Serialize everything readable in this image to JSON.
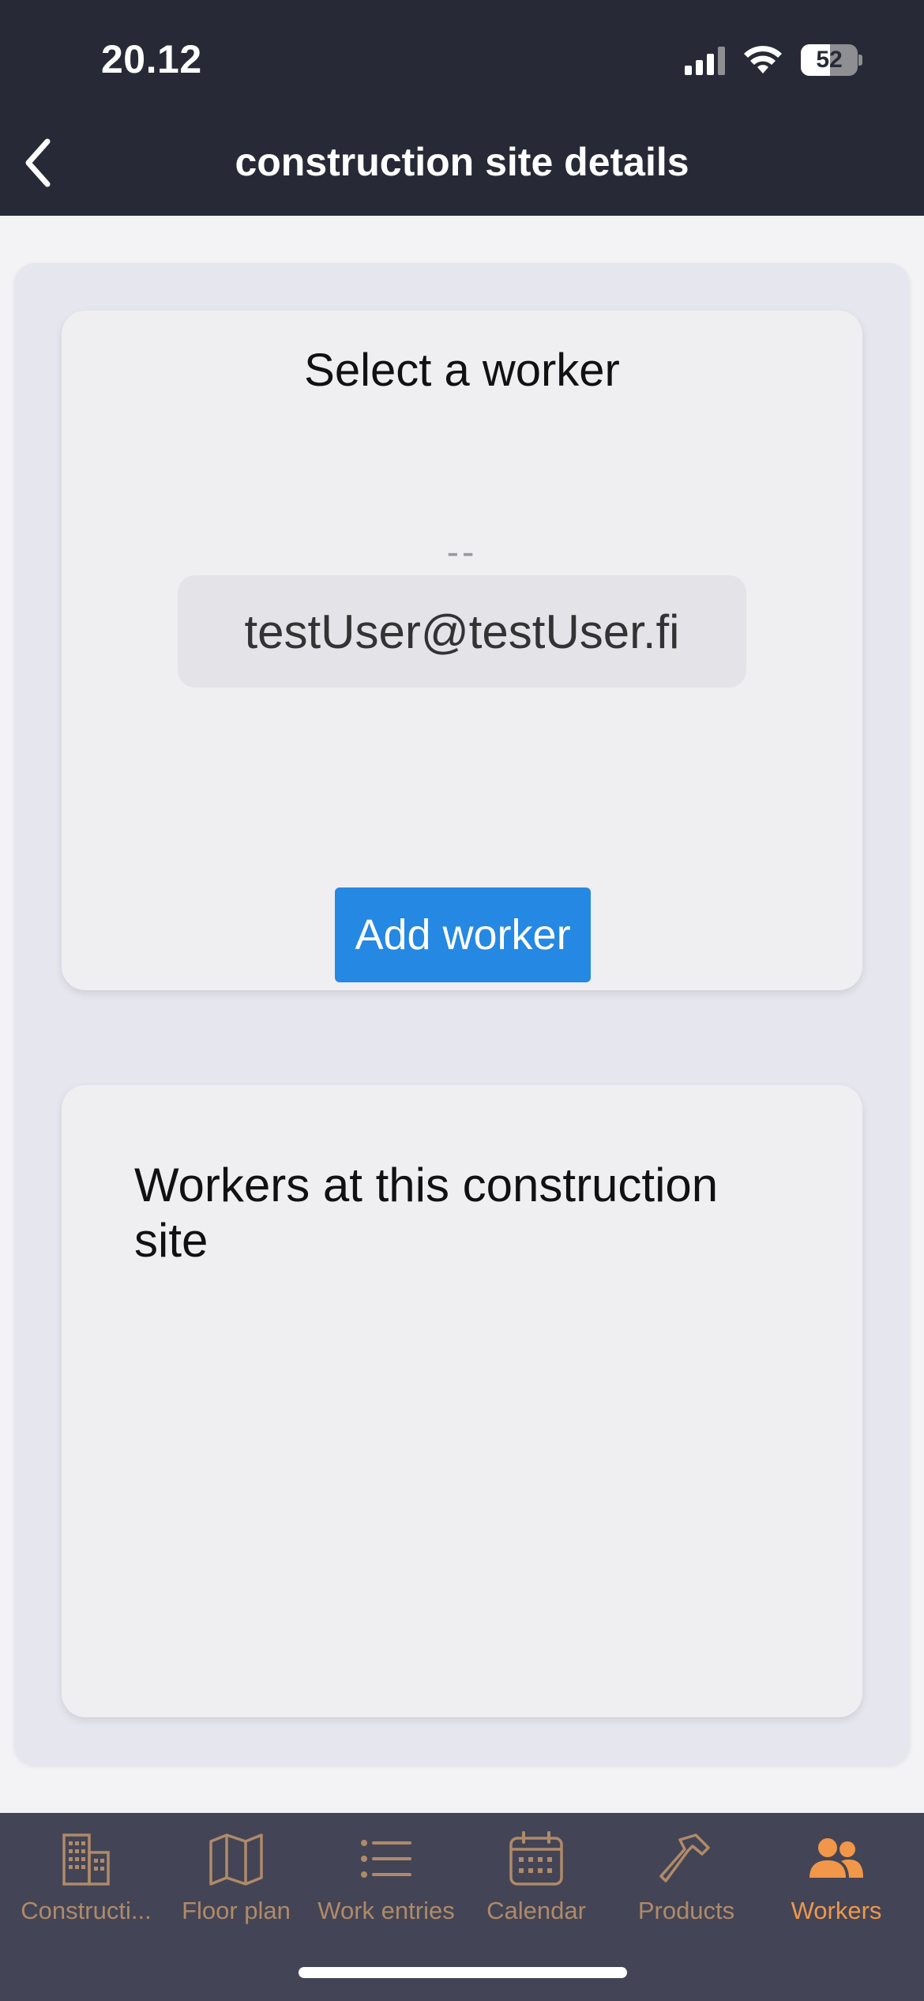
{
  "status_bar": {
    "time": "20.12",
    "battery": "52",
    "battery_level": 0.52
  },
  "header": {
    "title": "construction site details",
    "back_icon": "chevron-left-icon"
  },
  "select_card": {
    "title": "Select a worker",
    "placeholder": "--",
    "option": "testUser@testUser.fi",
    "button_label": "Add worker"
  },
  "workers_card": {
    "title": "Workers at this construction site"
  },
  "tabbar": {
    "accent_color": "#f0974a",
    "inactive_color": "#b08a68",
    "tabs": [
      {
        "label": "Constructi...",
        "icon": "building-icon",
        "active": false
      },
      {
        "label": "Floor plan",
        "icon": "map-icon",
        "active": false
      },
      {
        "label": "Work entries",
        "icon": "list-icon",
        "active": false
      },
      {
        "label": "Calendar",
        "icon": "calendar-icon",
        "active": false
      },
      {
        "label": "Products",
        "icon": "hammer-icon",
        "active": false
      },
      {
        "label": "Workers",
        "icon": "users-icon",
        "active": true
      }
    ]
  }
}
